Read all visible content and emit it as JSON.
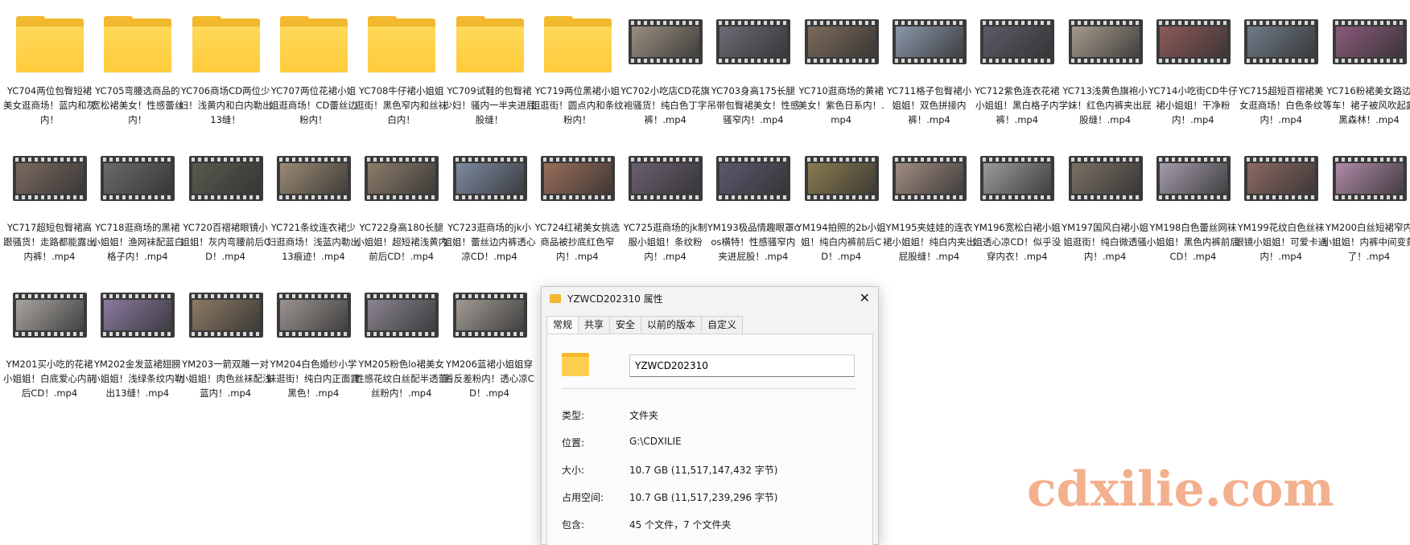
{
  "files": [
    {
      "label": "YC704两位包臀短裙美女逛商场！蓝内和灰内！",
      "type": "folder"
    },
    {
      "label": "YC705弯腰选商品的宽松裙美女！性感蕾丝内！",
      "type": "folder"
    },
    {
      "label": "YC706商场CD两位少妇！浅黄内和白内勒出13缝！",
      "type": "folder"
    },
    {
      "label": "YC707两位花裙小姐姐逛商场！CD蕾丝边粉内！",
      "type": "folder"
    },
    {
      "label": "YC708牛仔裙小姐姐逛街！黑色窄内和丝袜白内！",
      "type": "folder"
    },
    {
      "label": "YC709试鞋的包臀裙少妇！骚内一半夹进屁股缝！",
      "type": "folder"
    },
    {
      "label": "YC719两位黑裙小姐姐逛街！圆点内和条纹粉内！",
      "type": "folder"
    },
    {
      "label": "YC702小吃店CD花旗袍骚货！纯白色丁字裤！.mp4",
      "type": "video",
      "color": "#9a8f80"
    },
    {
      "label": "YC703身高175长腿吊带包臀裙美女！性感骚窄内！.mp4",
      "type": "video",
      "color": "#6d6a74"
    },
    {
      "label": "YC710逛商场的黄裙美女！紫色日系内！.mp4",
      "type": "video",
      "color": "#7b6a5a"
    },
    {
      "label": "YC711格子包臀裙小姐姐！双色拼接内裤！.mp4",
      "type": "video",
      "color": "#8a96a8"
    },
    {
      "label": "YC712紫色连衣花裙小姐姐！黑白格子内裤！.mp4",
      "type": "video",
      "color": "#5e5a66"
    },
    {
      "label": "YC713浅黄色旗袍小学妹！红色内裤夹出屁股缝！.mp4",
      "type": "video",
      "color": "#a59a8c"
    },
    {
      "label": "YC714小吃街CD牛仔裙小姐姐！干净粉内！.mp4",
      "type": "video",
      "color": "#8c5a58"
    },
    {
      "label": "YC715超短百褶裙美女逛商场！白色条纹内！.mp4",
      "type": "video",
      "color": "#6f7a86"
    },
    {
      "label": "YC716粉裙美女路边等车！裙子被风吹起露黑森林！.mp4",
      "type": "video",
      "color": "#8a5a7a"
    },
    {
      "label": "YC717超短包臀裙高跟骚货！走路都能露出内裤！.mp4",
      "type": "video",
      "color": "#7a6a60"
    },
    {
      "label": "YC718逛商场的黑裙小姐姐！渔网袜配蓝白格子内！.mp4",
      "type": "video",
      "color": "#6a6a6a"
    },
    {
      "label": "YC720百褶裙眼镜小姐姐！灰内弯腰前后CD！.mp4",
      "type": "video",
      "color": "#5a5a50"
    },
    {
      "label": "YC721条纹连衣裙少妇逛商场！浅蓝内勒出13痕迹！.mp4",
      "type": "video",
      "color": "#9a8a74"
    },
    {
      "label": "YC722身高180长腿小姐姐！超短裙浅黄内前后CD！.mp4",
      "type": "video",
      "color": "#8c7c6a"
    },
    {
      "label": "YC723逛商场的jk小姐姐！蕾丝边内裤透心凉CD！.mp4",
      "type": "video",
      "color": "#7d8aa0"
    },
    {
      "label": "YC724红裙美女挑选商品被抄底红色窄内！.mp4",
      "type": "video",
      "color": "#9a6e5a"
    },
    {
      "label": "YC725逛商场的jk制服小姐姐！条纹粉内！.mp4",
      "type": "video",
      "color": "#6a6070"
    },
    {
      "label": "YM193极品情趣眼罩cos横特！性感骚窄内夹进屁股！.mp4",
      "type": "video",
      "color": "#5a5a6e"
    },
    {
      "label": "YM194拍照的2b小姐姐！纯白内裤前后CD！.mp4",
      "type": "video",
      "color": "#8a7c50"
    },
    {
      "label": "YM195夹娃娃的连衣裙小姐姐！纯白内夹出屁股缝！.mp4",
      "type": "video",
      "color": "#a08c80"
    },
    {
      "label": "YM196宽松白裙小姐姐透心凉CD！似乎没穿内衣！.mp4",
      "type": "video",
      "color": "#9a9a9a"
    },
    {
      "label": "YM197国风白裙小姐姐逛街！纯白微透骚内！.mp4",
      "type": "video",
      "color": "#7a7064"
    },
    {
      "label": "YM198白色蕾丝网袜小姐姐！黑色内裤前后CD！.mp4",
      "type": "video",
      "color": "#a49caa"
    },
    {
      "label": "YM199花纹白色丝袜眼镜小姐姐！可爱卡通内！.mp4",
      "type": "video",
      "color": "#8c6a64"
    },
    {
      "label": "YM200白丝短裙窄内小姐姐！内裤中间变黄了！.mp4",
      "type": "video",
      "color": "#b08aa8"
    },
    {
      "label": "YM201买小吃的花裙小姐姐！白底爱心内前后CD！.mp4",
      "type": "video",
      "color": "#a8a4a0"
    },
    {
      "label": "YM202金发蓝裙翅膀小姐姐！浅绿条纹内勒出13缝！.mp4",
      "type": "video",
      "color": "#8a7aa0"
    },
    {
      "label": "YM203一箭双雕一对小姐姐！肉色丝袜配浅蓝内！.mp4",
      "type": "video",
      "color": "#8c7a64"
    },
    {
      "label": "YM204白色婚纱小学妹逛街！纯白内正面露黑色！.mp4",
      "type": "video",
      "color": "#9a9490"
    },
    {
      "label": "YM205粉色lo裙美女性感花纹白丝配半透蕾丝粉内！.mp4",
      "type": "video",
      "color": "#8a8490"
    },
    {
      "label": "YM206蓝裙小姐姐穿着反差粉内！透心凉CD！.mp4",
      "type": "video",
      "color": "#a09a94"
    }
  ],
  "dialog": {
    "title": "YZWCD202310 属性",
    "close": "✕",
    "tabs": [
      "常规",
      "共享",
      "安全",
      "以前的版本",
      "自定义"
    ],
    "active_tab": "常规",
    "folder_name": "YZWCD202310",
    "props": [
      {
        "key": "类型:",
        "value": "文件夹"
      },
      {
        "key": "位置:",
        "value": "G:\\CDXILIE"
      },
      {
        "key": "大小:",
        "value": "10.7 GB (11,517,147,432 字节)"
      },
      {
        "key": "占用空间:",
        "value": "10.7 GB (11,517,239,296 字节)"
      },
      {
        "key": "包含:",
        "value": "45 个文件，7 个文件夹"
      }
    ]
  },
  "watermark": "cdxilie.com"
}
